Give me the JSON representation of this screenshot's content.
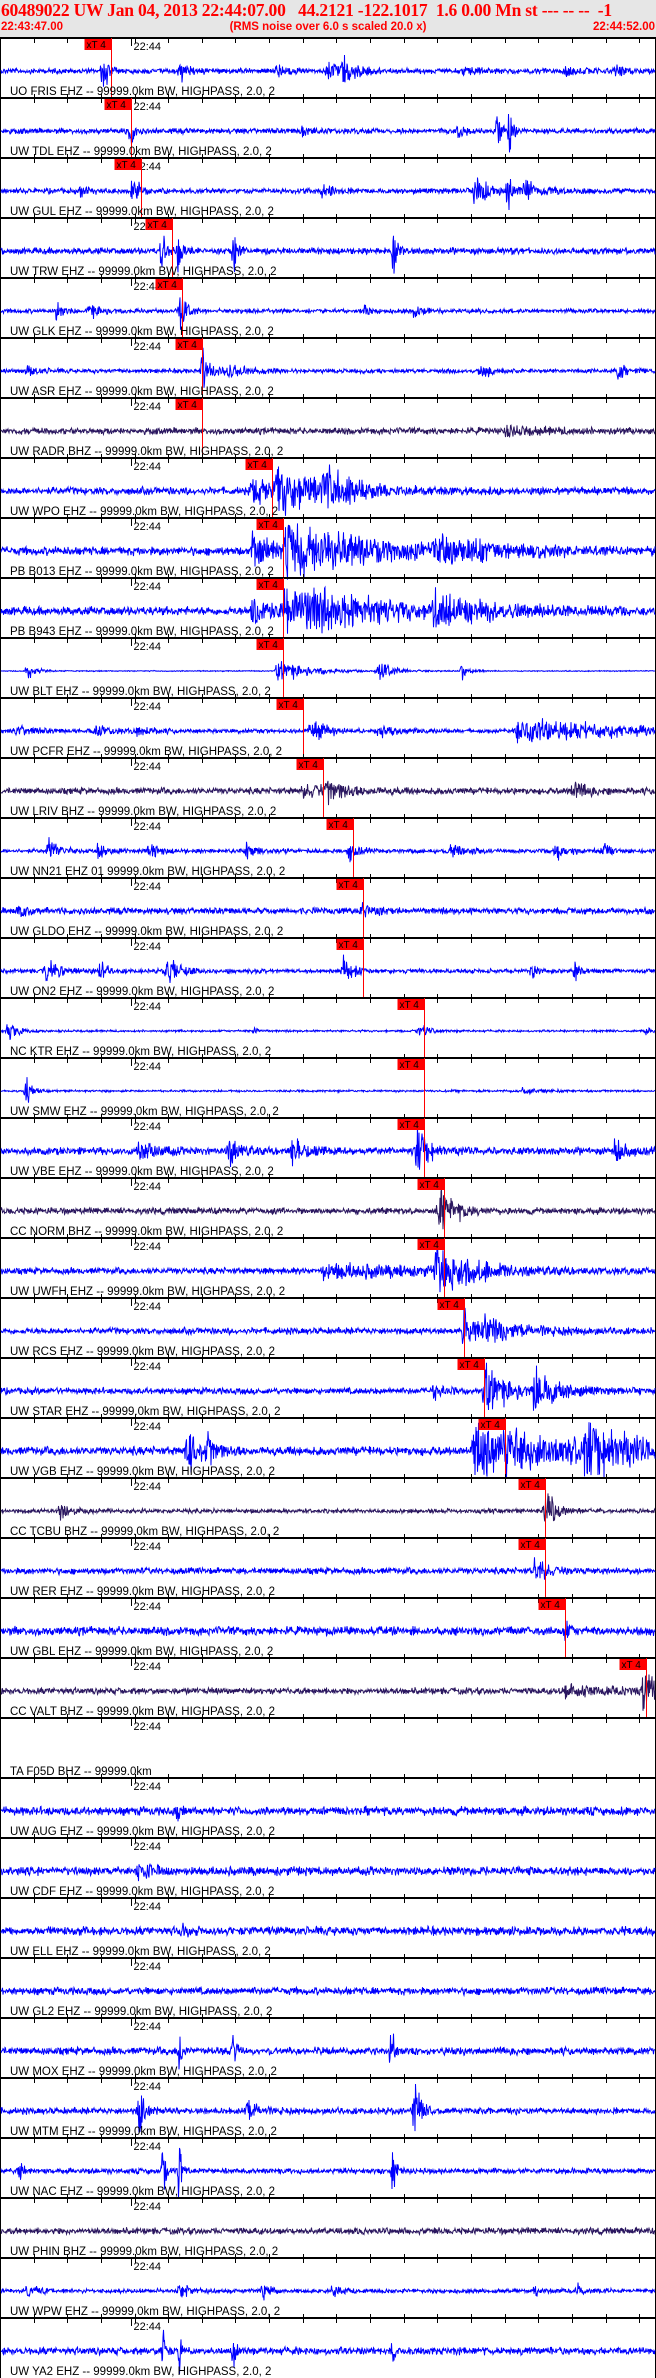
{
  "header": {
    "title": "60489022 UW Jan 04, 2013 22:44:07.00   44.2121 -122.1017  1.6 0.00 Mn st --- -- --  -1",
    "start_time": "22:43:47.00",
    "note": "(RMS noise over 6.0 s scaled 20.0 x)",
    "end_time": "22:44:52.00"
  },
  "colors": {
    "trace": "#0000ff",
    "trace_bb": "#2b1760",
    "pick": "#ff0000",
    "axis": "#000000",
    "header_bg": "#e6e6e6"
  },
  "chart_data": {
    "type": "line",
    "title": "60489022 UW Jan 04, 2013 22:44:07.00",
    "x_unit": "seconds after 22:43:47.00",
    "xlim": [
      0,
      65
    ],
    "minute_mark": {
      "label": "22:44",
      "t": 13
    },
    "pick_label": "xT 4",
    "traces": [
      {
        "label": "UO FRIS EHZ -- 99999.0km BW, HIGHPASS, 2.0, 2",
        "pick": 11,
        "bb": false,
        "noise": 2.5,
        "events": [
          [
            10.2,
            28,
            0.4
          ],
          [
            17.8,
            10,
            1
          ],
          [
            27.4,
            8,
            0.8
          ],
          [
            32.5,
            10,
            1
          ],
          [
            34,
            16,
            1.2
          ],
          [
            46,
            6,
            1
          ],
          [
            56,
            6,
            1
          ],
          [
            61,
            6,
            1
          ]
        ]
      },
      {
        "label": "UW TDL EHZ -- 99999.0km BW, HIGHPASS, 2.0, 2",
        "pick": 13,
        "bb": false,
        "noise": 2.5,
        "events": [
          [
            13,
            25,
            0.3
          ],
          [
            30,
            5,
            1
          ],
          [
            45.5,
            10,
            0.5
          ],
          [
            49.3,
            30,
            0.3
          ],
          [
            50.4,
            30,
            0.3
          ]
        ]
      },
      {
        "label": "UW GUL EHZ -- 99999.0km BW, HIGHPASS, 2.0, 2",
        "pick": 14,
        "bb": false,
        "noise": 2.5,
        "events": [
          [
            8,
            6,
            0.8
          ],
          [
            13.2,
            25,
            0.4
          ],
          [
            32,
            8,
            1
          ],
          [
            47,
            20,
            1
          ],
          [
            50.3,
            25,
            0.5
          ],
          [
            52,
            10,
            2
          ]
        ]
      },
      {
        "label": "UW TRW EHZ -- 99999.0km BW, HIGHPASS, 2.0, 2",
        "pick": 17,
        "bb": false,
        "noise": 3,
        "events": [
          [
            16.1,
            30,
            0.3
          ],
          [
            17.7,
            30,
            0.3
          ],
          [
            23.2,
            30,
            0.3
          ],
          [
            39,
            30,
            0.3
          ]
        ]
      },
      {
        "label": "UW GLK EHZ -- 99999.0km BW, HIGHPASS, 2.0, 2",
        "pick": 18,
        "bb": false,
        "noise": 2,
        "events": [
          [
            5.6,
            12,
            0.6
          ],
          [
            8.8,
            8,
            1
          ],
          [
            17.8,
            20,
            0.6
          ],
          [
            36.2,
            8,
            0.5
          ],
          [
            41,
            6,
            1
          ]
        ]
      },
      {
        "label": "UW ASR EHZ -- 99999.0km BW, HIGHPASS, 2.0, 2",
        "pick": 20,
        "bb": false,
        "noise": 2,
        "events": [
          [
            2.7,
            6,
            1
          ],
          [
            20,
            25,
            0.8
          ],
          [
            22.5,
            8,
            1.5
          ],
          [
            47.6,
            12,
            0.8
          ],
          [
            61.3,
            10,
            1
          ]
        ]
      },
      {
        "label": "UW RADR BHZ -- 99999.0km BW, HIGHPASS, 2.0, 2",
        "pick": 20,
        "bb": true,
        "noise": 3,
        "events": [
          [
            50,
            4,
            5
          ]
        ]
      },
      {
        "label": "UW WPO EHZ -- 99999.0km BW, HIGHPASS, 2.0, 2",
        "pick": 27,
        "bb": false,
        "noise": 3.5,
        "events": [
          [
            25,
            15,
            2
          ],
          [
            27.5,
            28,
            4
          ],
          [
            32,
            18,
            3
          ]
        ]
      },
      {
        "label": "PB B013 EHZ -- 99999.0km BW, HIGHPASS, 2.0, 2",
        "pick": 28,
        "bb": false,
        "noise": 4,
        "events": [
          [
            25,
            20,
            2
          ],
          [
            28.3,
            32,
            8
          ],
          [
            43,
            15,
            5
          ]
        ]
      },
      {
        "label": "PB B943 EHZ -- 99999.0km BW, HIGHPASS, 2.0, 2",
        "pick": 28,
        "bb": false,
        "noise": 4,
        "events": [
          [
            25,
            20,
            2
          ],
          [
            28.3,
            32,
            8
          ],
          [
            43,
            15,
            5
          ]
        ]
      },
      {
        "label": "UW BLT EHZ -- 99999.0km BW, HIGHPASS, 2.0, 2",
        "pick": 28,
        "bb": false,
        "noise": 0.5,
        "events": [
          [
            2.7,
            10,
            0.8
          ],
          [
            27.5,
            12,
            3
          ],
          [
            37.4,
            10,
            1.5
          ],
          [
            45.8,
            8,
            0.8
          ]
        ]
      },
      {
        "label": "UW PCFR EHZ -- 99999.0km BW, HIGHPASS, 2.0, 2",
        "pick": 30,
        "bb": false,
        "noise": 2,
        "events": [
          [
            1.5,
            6,
            1.5
          ],
          [
            9.4,
            6,
            1.5
          ],
          [
            13.5,
            5,
            1.5
          ],
          [
            30.8,
            14,
            1.5
          ],
          [
            37.6,
            8,
            1.5
          ],
          [
            51.3,
            14,
            10
          ]
        ]
      },
      {
        "label": "UW LRIV BHZ -- 99999.0km BW, HIGHPASS, 2.0, 2",
        "pick": 32,
        "bb": true,
        "noise": 3,
        "events": [
          [
            30,
            6,
            4
          ],
          [
            32.5,
            10,
            1.5
          ],
          [
            56.7,
            8,
            1.5
          ]
        ]
      },
      {
        "label": "UW NN21 EHZ 01 99999.0km BW, HIGHPASS, 2.0, 2",
        "pick": 35,
        "bb": false,
        "noise": 2,
        "events": [
          [
            4.8,
            14,
            1
          ],
          [
            9.7,
            8,
            1
          ],
          [
            14.8,
            8,
            1
          ],
          [
            24.4,
            10,
            1
          ],
          [
            34.6,
            14,
            0.8
          ],
          [
            44.8,
            12,
            1
          ],
          [
            55,
            10,
            1
          ],
          [
            59.8,
            8,
            0.8
          ]
        ]
      },
      {
        "label": "UW GLDO EHZ -- 99999.0km BW, HIGHPASS, 2.0, 2",
        "pick": 36,
        "bb": false,
        "noise": 3,
        "events": [
          [
            1.8,
            6,
            1
          ],
          [
            36,
            12,
            1
          ]
        ]
      },
      {
        "label": "UW ON2 EHZ -- 99999.0km BW, HIGHPASS, 2.0, 2",
        "pick": 36,
        "bb": false,
        "noise": 2,
        "events": [
          [
            4.5,
            10,
            2
          ],
          [
            10,
            12,
            0.5
          ],
          [
            16.5,
            16,
            1.2
          ],
          [
            34,
            14,
            1
          ],
          [
            52.7,
            10,
            0.5
          ],
          [
            57,
            10,
            0.5
          ]
        ]
      },
      {
        "label": "NC KTR EHZ -- 99999.0km BW, HIGHPASS, 2.0, 2",
        "pick": 42,
        "bb": false,
        "noise": 1,
        "events": [
          [
            0.8,
            10,
            1
          ],
          [
            25.2,
            8,
            0.3
          ],
          [
            41.5,
            8,
            1
          ],
          [
            64,
            4,
            0.5
          ]
        ]
      },
      {
        "label": "UW SMW EHZ -- 99999.0km BW, HIGHPASS, 2.0, 2",
        "pick": 42,
        "bb": false,
        "noise": 1,
        "events": [
          [
            2.6,
            15,
            0.5
          ],
          [
            51.8,
            4,
            2
          ]
        ]
      },
      {
        "label": "UW VBE EHZ -- 99999.0km BW, HIGHPASS, 2.0, 2",
        "pick": 42,
        "bb": false,
        "noise": 3.5,
        "events": [
          [
            13.8,
            14,
            1.5
          ],
          [
            22.7,
            14,
            1
          ],
          [
            29,
            14,
            1.5
          ],
          [
            41.3,
            30,
            1
          ],
          [
            60.8,
            12,
            1.5
          ]
        ]
      },
      {
        "label": "CC NORM BHZ -- 99999.0km BW, HIGHPASS, 2.0, 2",
        "pick": 44,
        "bb": true,
        "noise": 3,
        "events": [
          [
            43.5,
            25,
            1.5
          ]
        ]
      },
      {
        "label": "UW UWFH EHZ -- 99999.0km BW, HIGHPASS, 2.0, 2",
        "pick": 44,
        "bb": false,
        "noise": 3,
        "events": [
          [
            32,
            8,
            10
          ],
          [
            43.2,
            30,
            3
          ]
        ]
      },
      {
        "label": "UW RCS EHZ -- 99999.0km BW, HIGHPASS, 2.0, 2",
        "pick": 46,
        "bb": false,
        "noise": 3,
        "events": [
          [
            46,
            28,
            1
          ],
          [
            48,
            12,
            4
          ]
        ]
      },
      {
        "label": "UW STAR EHZ -- 99999.0km BW, HIGHPASS, 2.0, 2",
        "pick": 48,
        "bb": false,
        "noise": 3,
        "events": [
          [
            43,
            8,
            1
          ],
          [
            48,
            30,
            2
          ],
          [
            53,
            25,
            2
          ]
        ]
      },
      {
        "label": "UW VGB EHZ -- 99999.0km BW, HIGHPASS, 2.0, 2",
        "pick": 50,
        "bb": false,
        "noise": 4,
        "events": [
          [
            18.5,
            20,
            1.5
          ],
          [
            20.5,
            12,
            1
          ],
          [
            47,
            32,
            10
          ],
          [
            58,
            30,
            3
          ]
        ]
      },
      {
        "label": "CC TCBU BHZ -- 99999.0km BW, HIGHPASS, 2.0, 2",
        "pick": 54,
        "bb": true,
        "noise": 2,
        "events": [
          [
            6,
            10,
            1
          ],
          [
            54,
            28,
            1
          ]
        ]
      },
      {
        "label": "UW RER EHZ -- 99999.0km BW, HIGHPASS, 2.0, 2",
        "pick": 54,
        "bb": false,
        "noise": 3,
        "events": [
          [
            53,
            18,
            1
          ]
        ]
      },
      {
        "label": "UW GBL EHZ -- 99999.0km BW, HIGHPASS, 2.0, 2",
        "pick": 56,
        "bb": false,
        "noise": 4,
        "events": [
          [
            56,
            10,
            0.5
          ]
        ]
      },
      {
        "label": "CC VALT BHZ -- 99999.0km BW, HIGHPASS, 2.0, 2",
        "pick": 64,
        "bb": true,
        "noise": 3,
        "events": [
          [
            56,
            8,
            3
          ],
          [
            63.8,
            28,
            1
          ]
        ]
      },
      {
        "label": "TA F05D BHZ -- 99999.0km",
        "pick": null,
        "bb": true,
        "noise": 0,
        "events": [],
        "empty": true
      },
      {
        "label": "UW AUG EHZ -- 99999.0km BW, HIGHPASS, 2.0, 2",
        "pick": null,
        "bb": false,
        "noise": 4,
        "events": [
          [
            17.5,
            8,
            0.3
          ]
        ]
      },
      {
        "label": "UW CDF EHZ -- 99999.0km BW, HIGHPASS, 2.0, 2",
        "pick": null,
        "bb": false,
        "noise": 4,
        "events": [
          [
            13.7,
            14,
            1
          ]
        ]
      },
      {
        "label": "UW ELL EHZ -- 99999.0km BW, HIGHPASS, 2.0, 2",
        "pick": null,
        "bb": false,
        "noise": 4,
        "events": [
          [
            18,
            6,
            0.5
          ]
        ]
      },
      {
        "label": "UW GL2 EHZ -- 99999.0km BW, HIGHPASS, 2.0, 2",
        "pick": null,
        "bb": false,
        "noise": 3.5,
        "events": []
      },
      {
        "label": "UW MOX EHZ -- 99999.0km BW, HIGHPASS, 2.0, 2",
        "pick": null,
        "bb": false,
        "noise": 3.5,
        "events": [
          [
            17.8,
            20,
            0.3
          ],
          [
            23.2,
            35,
            0.2
          ],
          [
            38.8,
            35,
            0.2
          ]
        ]
      },
      {
        "label": "UW MTM EHZ -- 99999.0km BW, HIGHPASS, 2.0, 2",
        "pick": null,
        "bb": false,
        "noise": 3,
        "events": [
          [
            13.8,
            30,
            0.5
          ],
          [
            24.5,
            12,
            1
          ],
          [
            41.1,
            30,
            0.6
          ]
        ]
      },
      {
        "label": "UW NAC EHZ -- 99999.0km BW, HIGHPASS, 2.0, 2",
        "pick": null,
        "bb": false,
        "noise": 2.5,
        "events": [
          [
            2,
            12,
            0.3
          ],
          [
            16.2,
            35,
            0.2
          ],
          [
            17.8,
            35,
            0.2
          ],
          [
            39,
            35,
            0.2
          ]
        ]
      },
      {
        "label": "UW PHIN BHZ -- 99999.0km BW, HIGHPASS, 2.0, 2",
        "pick": null,
        "bb": true,
        "noise": 3,
        "events": []
      },
      {
        "label": "UW WPW EHZ -- 99999.0km BW, HIGHPASS, 2.0, 2",
        "pick": null,
        "bb": false,
        "noise": 2,
        "events": [
          [
            2.7,
            10,
            0.8
          ],
          [
            17.8,
            10,
            0.8
          ],
          [
            26,
            8,
            0.8
          ],
          [
            33,
            6,
            1
          ],
          [
            53,
            6,
            0.5
          ],
          [
            57.3,
            8,
            0.3
          ]
        ]
      },
      {
        "label": "UW YA2 EHZ -- 99999.0km BW, HIGHPASS, 2.0, 2",
        "pick": null,
        "bb": false,
        "noise": 3.5,
        "events": [
          [
            16.2,
            30,
            0.2
          ],
          [
            17.8,
            25,
            0.2
          ],
          [
            23.2,
            30,
            0.2
          ],
          [
            39,
            15,
            0.2
          ]
        ]
      }
    ]
  }
}
